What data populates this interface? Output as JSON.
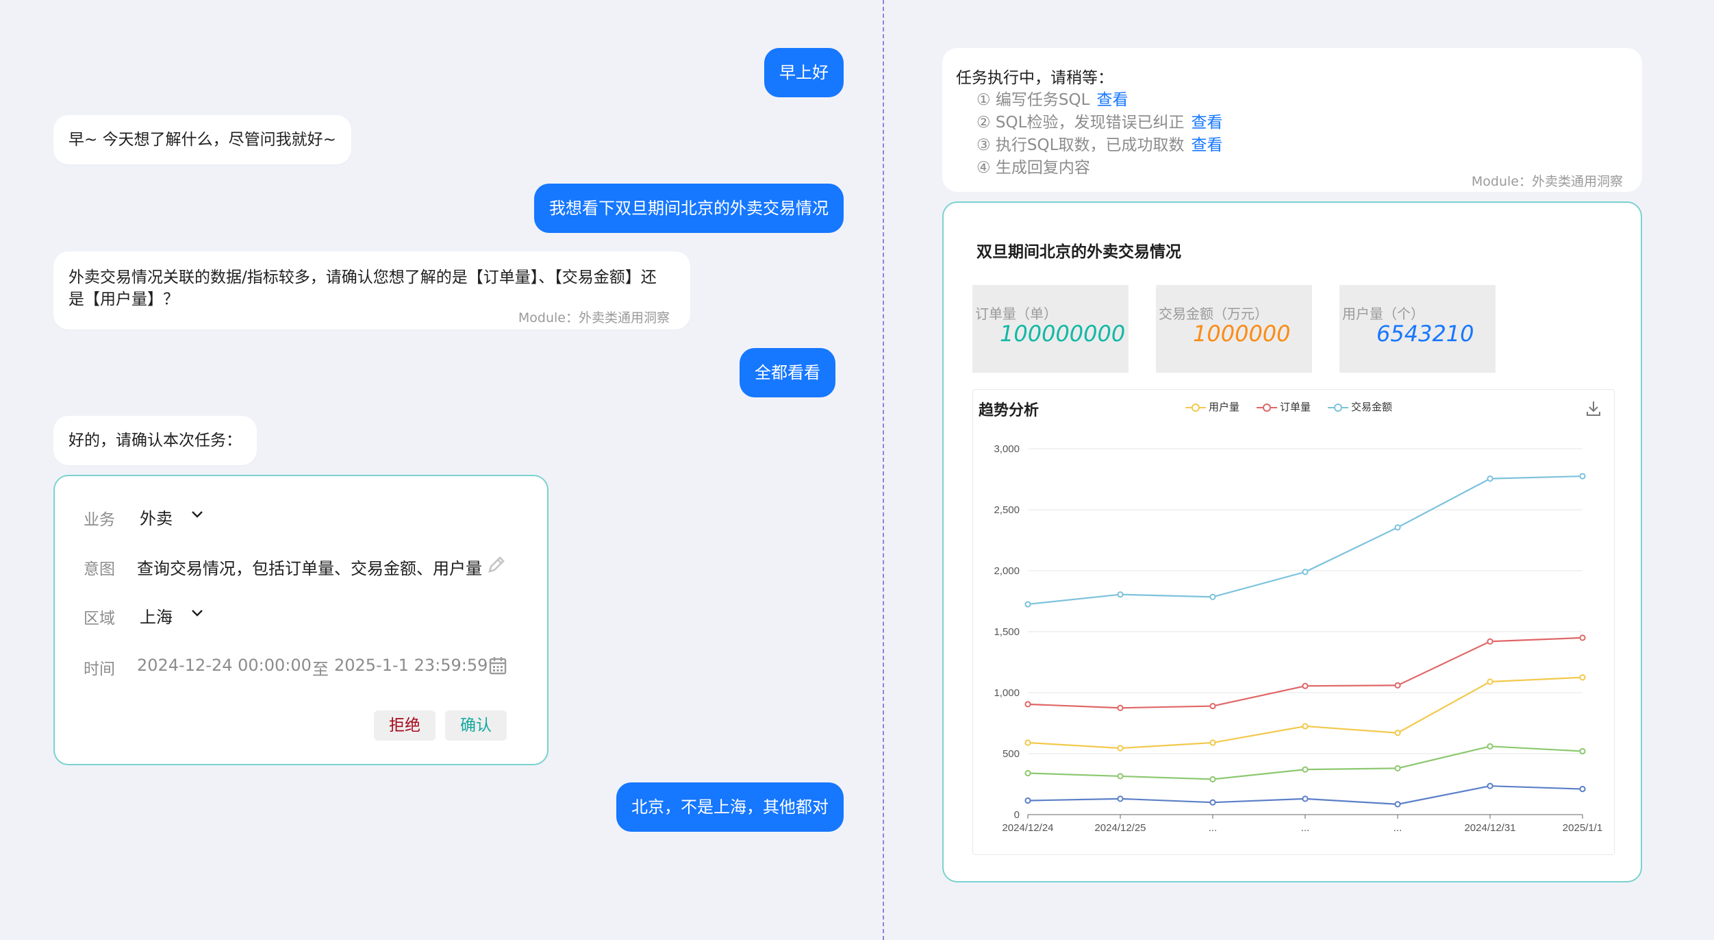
{
  "chat": {
    "user_1": "早上好",
    "bot_1": "早~  今天想了解什么，尽管问我就好~",
    "user_2": "我想看下双旦期间北京的外卖交易情况",
    "bot_2_line1": "外卖交易情况关联的数据/指标较多，请确认您想了解的是【订单量】、【交易金额】还",
    "bot_2_line2": "是【用户量】？",
    "bot_2_module": "Module：外卖类通用洞察",
    "user_3": "全都看看",
    "bot_3": "好的，请确认本次任务：",
    "user_4": "北京，不是上海，其他都对"
  },
  "task_form": {
    "business_label": "业务",
    "business_value": "外卖",
    "intent_label": "意图",
    "intent_value": "查询交易情况，包括订单量、交易金额、用户量",
    "region_label": "区域",
    "region_value": "上海",
    "time_label": "时间",
    "time_start": "2024-12-24 00:00:00",
    "time_sep": "至",
    "time_end": "2025-1-1 23:59:59",
    "reject_label": "拒绝",
    "confirm_label": "确认",
    "icons": [
      "chevron-down-icon",
      "pencil-icon",
      "calendar-icon"
    ]
  },
  "progress": {
    "title": "任务执行中，请稍等：",
    "steps": [
      {
        "text": "① 编写任务SQL",
        "link": "查看"
      },
      {
        "text": "② SQL检验，发现错误已纠正",
        "link": "查看"
      },
      {
        "text": "③ 执行SQL取数，已成功取数",
        "link": "查看"
      },
      {
        "text": "④ 生成回复内容",
        "link": ""
      }
    ],
    "module": "Module：外卖类通用洞察"
  },
  "report": {
    "title": "双旦期间北京的外卖交易情况",
    "metrics": [
      {
        "label": "订单量（单）",
        "value": "100000000",
        "color": "#13b8a6"
      },
      {
        "label": "交易金额（万元）",
        "value": "1000000",
        "color": "#fa8c16"
      },
      {
        "label": "用户量（个）",
        "value": "6543210",
        "color": "#1677ff"
      }
    ],
    "chart_title": "趋势分析",
    "download_icon": "download-icon"
  },
  "chart_data": {
    "type": "line",
    "title": "趋势分析",
    "categories": [
      "2024/12/24",
      "2024/12/25",
      "...",
      "...",
      "...",
      "2024/12/31",
      "2025/1/1"
    ],
    "x_tick_labels": [
      "2024/12/24",
      "2024/12/25",
      "...",
      "...",
      "...",
      "2024/12/31",
      "2025/1/1"
    ],
    "y_tick_labels": [
      "0",
      "500",
      "1,000",
      "1,500",
      "2,000",
      "2,500",
      "3,000"
    ],
    "ylim": [
      0,
      3000
    ],
    "legend": [
      "用户量",
      "订单量",
      "交易金额"
    ],
    "legend_position": "top",
    "grid": true,
    "series": [
      {
        "name": "用户量",
        "color": "#f2c94c",
        "values": [
          590,
          545,
          590,
          725,
          670,
          1090,
          1125
        ]
      },
      {
        "name": "订单量",
        "color": "#e06666",
        "values": [
          905,
          875,
          890,
          1055,
          1060,
          1420,
          1450
        ]
      },
      {
        "name": "交易金额",
        "color": "#7cc2dc",
        "values": [
          1725,
          1805,
          1785,
          1990,
          2355,
          2755,
          2775
        ]
      },
      {
        "color": "#8cc86f",
        "values": [
          340,
          315,
          290,
          370,
          380,
          560,
          520
        ]
      },
      {
        "color": "#5b7fc7",
        "values": [
          115,
          130,
          100,
          130,
          85,
          235,
          210
        ]
      }
    ]
  }
}
